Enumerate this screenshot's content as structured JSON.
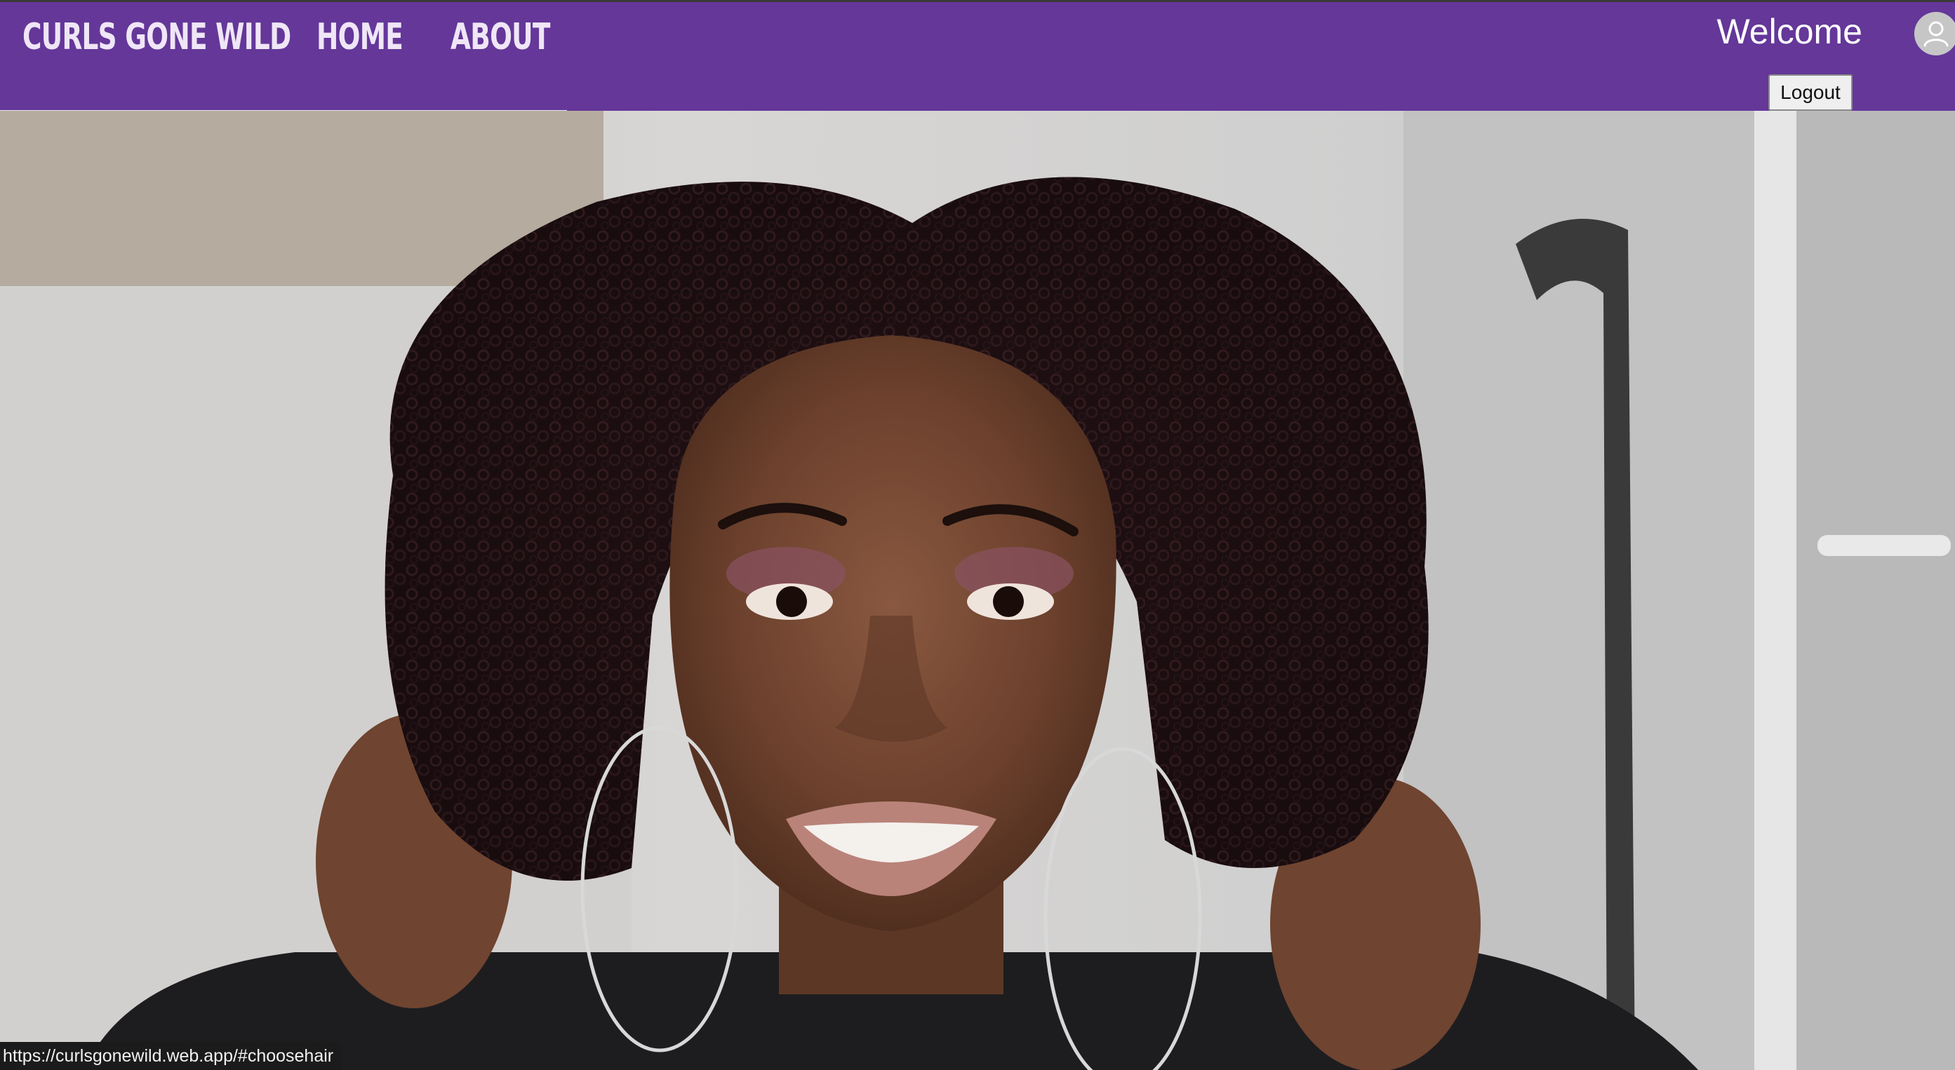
{
  "navbar": {
    "brand": "CURLS GONE WILD",
    "links": [
      {
        "label": "HOME"
      },
      {
        "label": "ABOUT"
      }
    ],
    "welcome": "Welcome",
    "logout_label": "Logout",
    "accent_color": "#643799",
    "avatar_icon": "user-avatar-icon"
  },
  "hero": {
    "image_subject": "hero-photo"
  },
  "status_bar": {
    "url": "https://curlsgonewild.web.app/#choosehair"
  }
}
